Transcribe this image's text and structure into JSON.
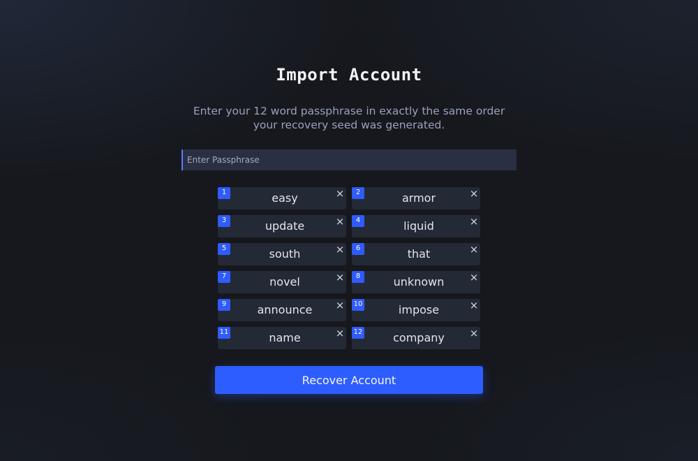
{
  "page": {
    "title": "Import Account",
    "subtitle": "Enter your 12 word passphrase in exactly the same order your recovery seed was generated."
  },
  "passphrase_input": {
    "value": "",
    "placeholder": "Enter Passphrase"
  },
  "words": [
    {
      "index": "1",
      "word": "easy"
    },
    {
      "index": "2",
      "word": "armor"
    },
    {
      "index": "3",
      "word": "update"
    },
    {
      "index": "4",
      "word": "liquid"
    },
    {
      "index": "5",
      "word": "south"
    },
    {
      "index": "6",
      "word": "that"
    },
    {
      "index": "7",
      "word": "novel"
    },
    {
      "index": "8",
      "word": "unknown"
    },
    {
      "index": "9",
      "word": "announce"
    },
    {
      "index": "10",
      "word": "impose"
    },
    {
      "index": "11",
      "word": "name"
    },
    {
      "index": "12",
      "word": "company"
    }
  ],
  "remove_icon": "close-icon",
  "remove_glyph": "×",
  "actions": {
    "recover_label": "Recover Account"
  },
  "colors": {
    "accent": "#2e5dff",
    "background": "#16181d",
    "chip_background": "#242936"
  }
}
